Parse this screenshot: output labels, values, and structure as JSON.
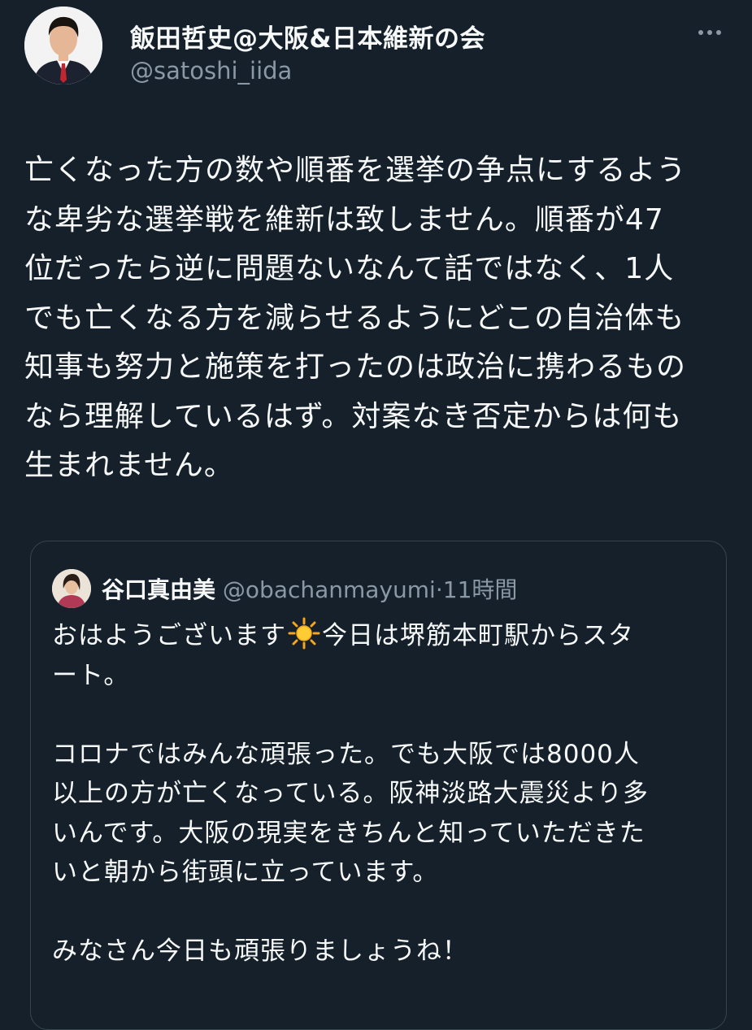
{
  "author": {
    "name": "飯田哲史@大阪&日本維新の会",
    "handle": "@satoshi_iida",
    "avatar_icon": "person-portrait-icon"
  },
  "menu": {
    "icon": "more-options-icon"
  },
  "tweet": {
    "lines": [
      "亡くなった方の数や順番を選挙の争点にするよう",
      "な卑劣な選挙戦を維新は致しません。順番が47",
      "位だったら逆に問題ないなんて話ではなく、1人",
      "でも亡くなる方を減らせるようにどこの自治体も",
      "知事も努力と施策を打ったのは政治に携わるもの",
      "なら理解しているはず。対案なき否定からは何も",
      "生まれません。"
    ]
  },
  "quote": {
    "name": "谷口真由美",
    "handle": "@obachanmayumi",
    "separator": "·",
    "time": "11時間",
    "avatar_icon": "person-portrait-icon",
    "line1_before": "おはようございます",
    "line1_icon": "sun-icon",
    "line1_after": "今日は堺筋本町駅からスタ",
    "line2": "ート。",
    "paragraph2": [
      "コロナではみんな頑張った。でも大阪では8000人",
      "以上の方が亡くなっている。阪神淡路大震災より多",
      "いんです。大阪の現実をきちんと知っていただきた",
      "いと朝から街頭に立っています。"
    ],
    "paragraph3": [
      "みなさん今日も頑張りましょうね！"
    ]
  },
  "colors": {
    "background": "#15202b",
    "text_primary": "#f7f9f9",
    "text_secondary": "#8b98a5",
    "border": "#38444d"
  }
}
